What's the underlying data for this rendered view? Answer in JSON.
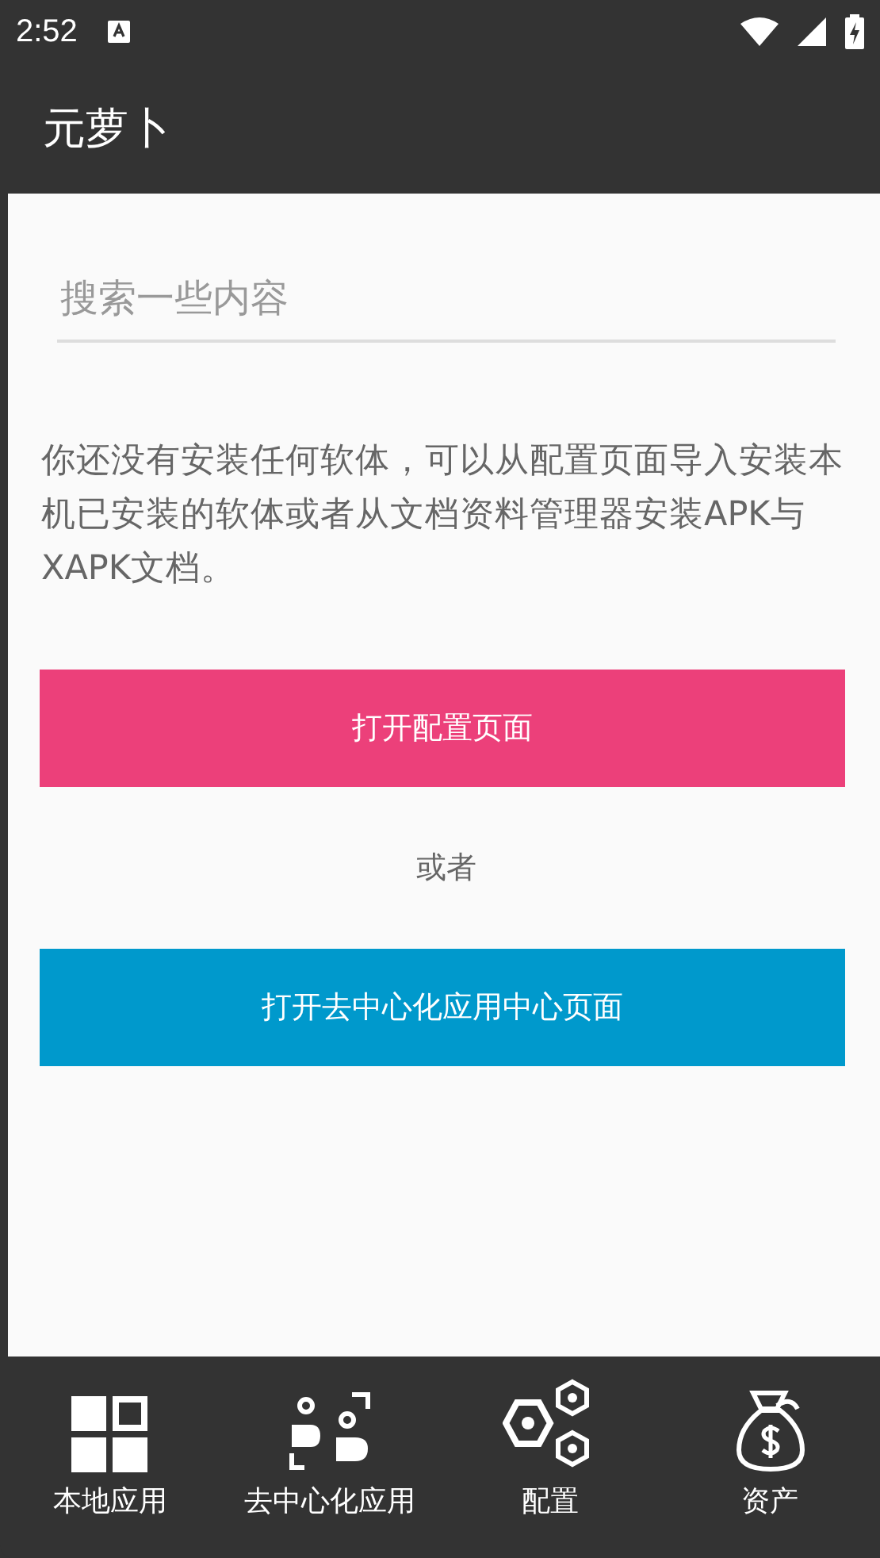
{
  "status_bar": {
    "time": "2:52"
  },
  "app_bar": {
    "title": "元萝卜"
  },
  "search": {
    "placeholder": "搜索一些内容"
  },
  "message": "你还没有安装任何软体，可以从配置页面导入安装本机已安装的软体或者从文档资料管理器安装APK与XAPK文档。",
  "buttons": [
    {
      "kind": "primary",
      "label": "打开配置页面"
    },
    {
      "kind": "separator",
      "label": "或者"
    },
    {
      "kind": "secondary",
      "label": "打开去中心化应用中心页面"
    }
  ],
  "bottom_nav": [
    {
      "kind": "grid",
      "label": "本地应用"
    },
    {
      "kind": "people",
      "label": "去中心化应用"
    },
    {
      "kind": "hex",
      "label": "配置"
    },
    {
      "kind": "bag",
      "label": "资产"
    }
  ]
}
